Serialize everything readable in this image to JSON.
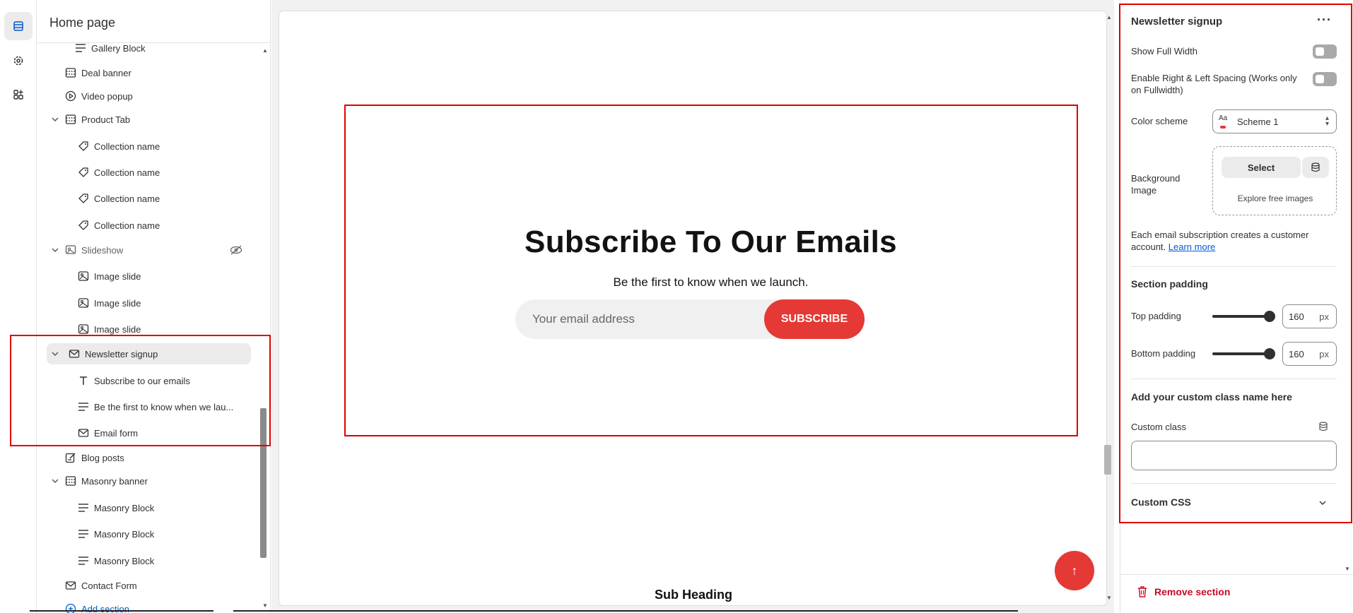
{
  "sidebar": {
    "title": "Home page",
    "items": [
      {
        "label": "Gallery Block",
        "icon": "text-lines-icon",
        "level": 2
      },
      {
        "label": "Deal banner",
        "icon": "section-icon",
        "level": 1
      },
      {
        "label": "Video popup",
        "icon": "play-circle-icon",
        "level": 1
      },
      {
        "label": "Product Tab",
        "icon": "section-icon",
        "level": 1
      },
      {
        "label": "Collection name",
        "icon": "tag-icon",
        "level": 2
      },
      {
        "label": "Collection name",
        "icon": "tag-icon",
        "level": 2
      },
      {
        "label": "Collection name",
        "icon": "tag-icon",
        "level": 2
      },
      {
        "label": "Collection name",
        "icon": "tag-icon",
        "level": 2
      },
      {
        "label": "Slideshow",
        "icon": "slideshow-icon",
        "level": 1
      },
      {
        "label": "Image slide",
        "icon": "image-icon",
        "level": 2
      },
      {
        "label": "Image slide",
        "icon": "image-icon",
        "level": 2
      },
      {
        "label": "Image slide",
        "icon": "image-icon",
        "level": 2
      },
      {
        "label": "Newsletter signup",
        "icon": "mail-icon",
        "level": 1
      },
      {
        "label": "Subscribe to our emails",
        "icon": "text-t-icon",
        "level": 2
      },
      {
        "label": "Be the first to know when we lau...",
        "icon": "text-lines-icon",
        "level": 2
      },
      {
        "label": "Email form",
        "icon": "mail-icon",
        "level": 2
      },
      {
        "label": "Blog posts",
        "icon": "blog-icon",
        "level": 1
      },
      {
        "label": "Masonry banner",
        "icon": "section-icon",
        "level": 1
      },
      {
        "label": "Masonry Block",
        "icon": "text-lines-icon",
        "level": 2
      },
      {
        "label": "Masonry Block",
        "icon": "text-lines-icon",
        "level": 2
      },
      {
        "label": "Masonry Block",
        "icon": "text-lines-icon",
        "level": 2
      },
      {
        "label": "Contact Form",
        "icon": "mail-icon",
        "level": 1
      }
    ],
    "add_section": "Add section"
  },
  "preview": {
    "newsletter_title": "Subscribe To Our Emails",
    "newsletter_subtitle": "Be the first to know when we launch.",
    "email_placeholder": "Your email address",
    "subscribe_label": "SUBSCRIBE",
    "sub_heading": "Sub Heading",
    "accent_color": "#e53935"
  },
  "settings": {
    "title": "Newsletter signup",
    "show_full_width": "Show Full Width",
    "spacing_label": "Enable Right & Left Spacing (Works only on Fullwidth)",
    "color_scheme_label": "Color scheme",
    "color_scheme_icon": "Aa",
    "color_scheme_value": "Scheme 1",
    "background_image_label": "Background Image",
    "select_label": "Select",
    "explore_label": "Explore free images",
    "info_text": "Each email subscription creates a customer account.",
    "learn_more": "Learn more",
    "section_padding": "Section padding",
    "top_padding_label": "Top padding",
    "top_padding_value": "160",
    "bottom_padding_label": "Bottom padding",
    "bottom_padding_value": "160",
    "unit": "px",
    "custom_class_heading": "Add your custom class name here",
    "custom_class_label": "Custom class",
    "custom_css": "Custom CSS",
    "remove_section": "Remove section"
  }
}
